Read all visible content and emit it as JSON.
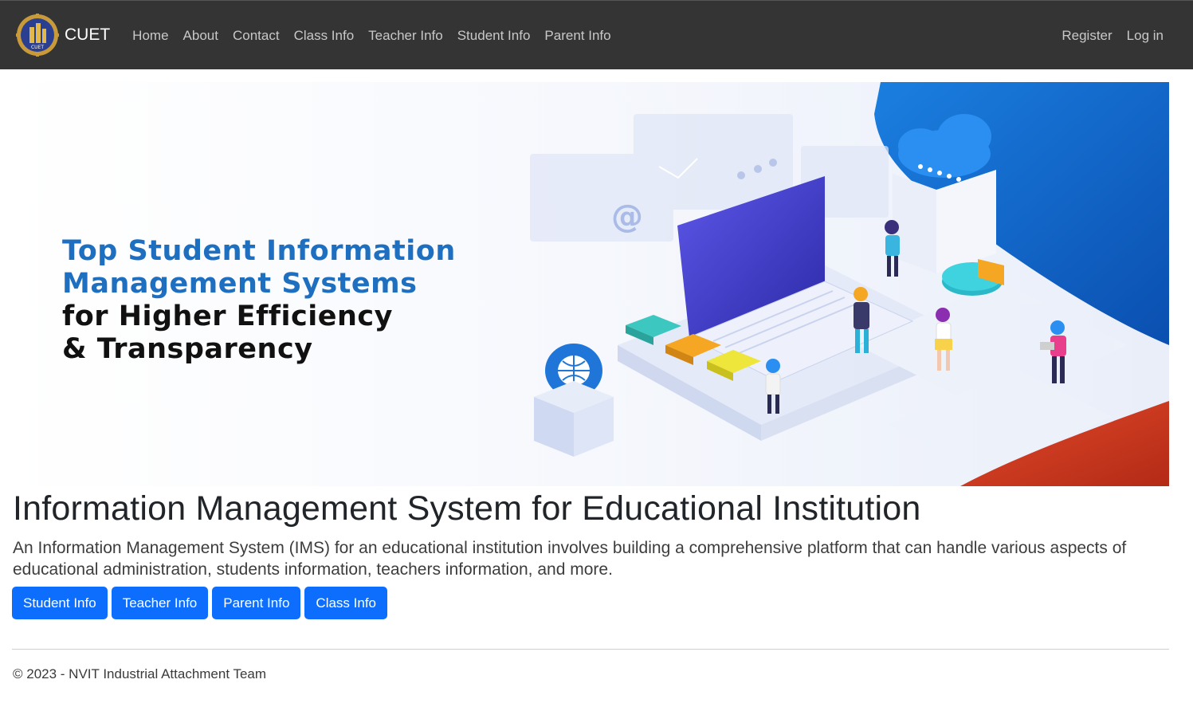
{
  "navbar": {
    "brand": "CUET",
    "logo_text": "CUET",
    "links": [
      "Home",
      "About",
      "Contact",
      "Class Info",
      "Teacher Info",
      "Student Info",
      "Parent Info"
    ],
    "right_links": [
      "Register",
      "Log in"
    ]
  },
  "hero": {
    "line1": "Top Student Information",
    "line2": "Management Systems",
    "line3": "for Higher Efficiency",
    "line4": "& Transparency",
    "at_symbol": "@"
  },
  "main": {
    "title": "Information Management System for Educational Institution",
    "lead": "An Information Management System (IMS) for an educational institution involves building a comprehensive platform that can handle various aspects of educational administration, students information, teachers information, and more.",
    "buttons": [
      "Student Info",
      "Teacher Info",
      "Parent Info",
      "Class Info"
    ]
  },
  "footer": {
    "text": "© 2023 - NVIT Industrial Attachment Team"
  },
  "colors": {
    "navbar_bg": "#343434",
    "button_bg": "#0d6efd",
    "hero_blue": "#1f6fc0"
  }
}
